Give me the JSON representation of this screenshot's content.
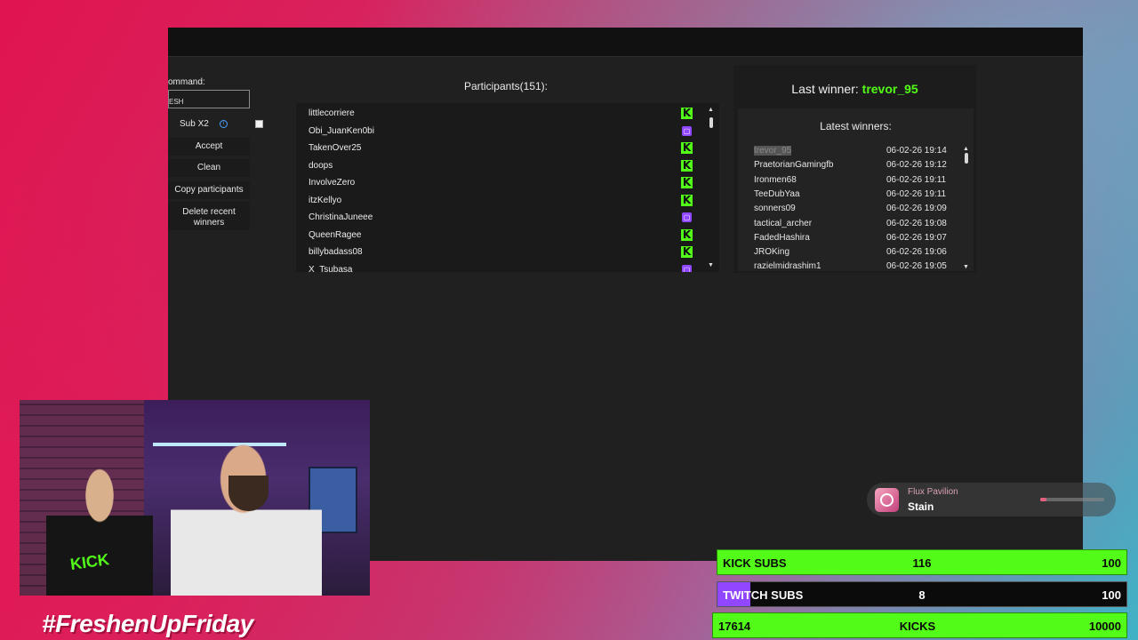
{
  "left_panel": {
    "command_label": "ommand:",
    "command_value": "ESH",
    "sub_label": "Sub X2",
    "buttons": {
      "accept": "Accept",
      "clean": "Clean",
      "copy": "Copy participants",
      "delete": "Delete recent winners"
    }
  },
  "participants": {
    "title": "Participants(151):",
    "rows": [
      {
        "name": "littlecorriere",
        "platform": "kick"
      },
      {
        "name": "Obi_JuanKen0bi",
        "platform": "twitch"
      },
      {
        "name": "TakenOver25",
        "platform": "kick"
      },
      {
        "name": "doops",
        "platform": "kick"
      },
      {
        "name": "InvolveZero",
        "platform": "kick"
      },
      {
        "name": "itzKellyo",
        "platform": "kick"
      },
      {
        "name": "ChristinaJuneee",
        "platform": "twitch"
      },
      {
        "name": "QueenRagee",
        "platform": "kick"
      },
      {
        "name": "billybadass08",
        "platform": "kick"
      },
      {
        "name": "X_Tsubasa",
        "platform": "twitch"
      }
    ]
  },
  "winners": {
    "last_winner_label": "Last winner:",
    "last_winner_name": "trevor_95",
    "latest_title": "Latest winners:",
    "rows": [
      {
        "name": "trevor_95",
        "date": "06-02-26 19:14"
      },
      {
        "name": "PraetorianGamingfb",
        "date": "06-02-26 19:12"
      },
      {
        "name": "Ironmen68",
        "date": "06-02-26 19:11"
      },
      {
        "name": "TeeDubYaa",
        "date": "06-02-26 19:11"
      },
      {
        "name": "sonners09",
        "date": "06-02-26 19:09"
      },
      {
        "name": "tactical_archer",
        "date": "06-02-26 19:08"
      },
      {
        "name": "FadedHashira",
        "date": "06-02-26 19:07"
      },
      {
        "name": "JROKing",
        "date": "06-02-26 19:06"
      },
      {
        "name": "razielmidrashim1",
        "date": "06-02-26 19:05"
      }
    ]
  },
  "hashtag": "#FreshenUpFriday",
  "music": {
    "artist": "Flux Pavilion",
    "title": "Stain",
    "progress": 0.1
  },
  "goals": {
    "kick_subs": {
      "label": "KICK SUBS",
      "count": "116",
      "target": "100",
      "fill": 1.0
    },
    "twitch_subs": {
      "label": "TWITCH SUBS",
      "count": "8",
      "target": "100",
      "fill": 0.08
    },
    "kicks": {
      "label": "KICKS",
      "count": "17614",
      "target": "10000",
      "fill": 1.0
    }
  },
  "colors": {
    "kick_green": "#53fc18",
    "twitch_purple": "#9146ff",
    "app_bg": "#202020"
  },
  "icons": {
    "kick": "K",
    "twitch": "twitch-icon",
    "info": "i"
  }
}
